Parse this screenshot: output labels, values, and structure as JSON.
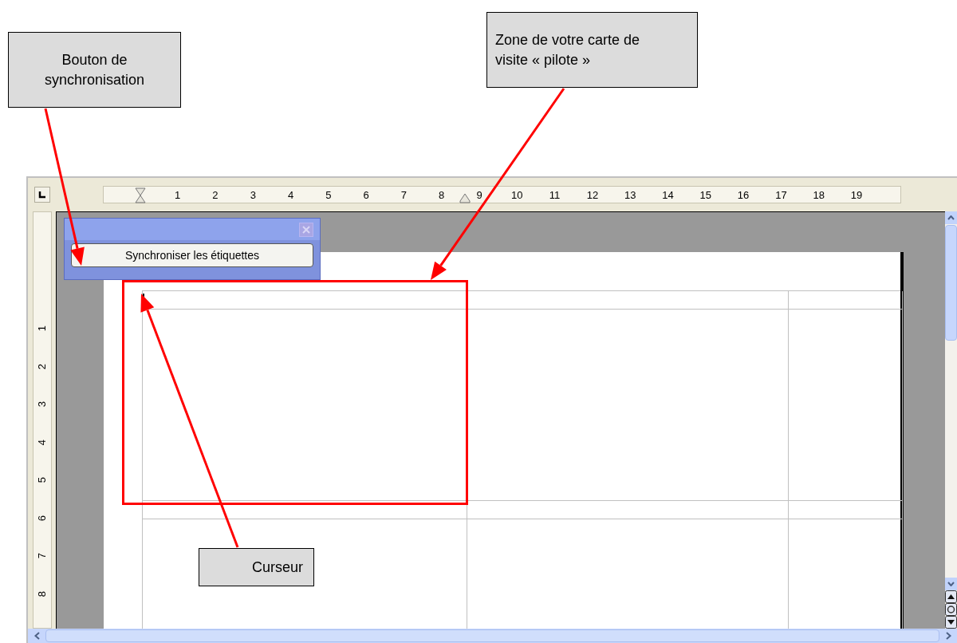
{
  "callouts": [
    {
      "kind": "sync",
      "text": "Bouton  de\nsynchronisation"
    },
    {
      "kind": "zone",
      "text": "Zone de votre carte de\nvisite « pilote »"
    },
    {
      "kind": "cursor",
      "text": "Curseur"
    }
  ],
  "ruler": {
    "horizontal": [
      "1",
      "2",
      "3",
      "4",
      "5",
      "6",
      "7",
      "8",
      "9",
      "10",
      "11",
      "12",
      "13",
      "14",
      "15",
      "16",
      "17",
      "18",
      "19"
    ],
    "vertical": [
      "1",
      "2",
      "3",
      "4",
      "5",
      "6",
      "7",
      "8"
    ]
  },
  "toolbar": {
    "button": "Synchroniser les étiquettes"
  }
}
